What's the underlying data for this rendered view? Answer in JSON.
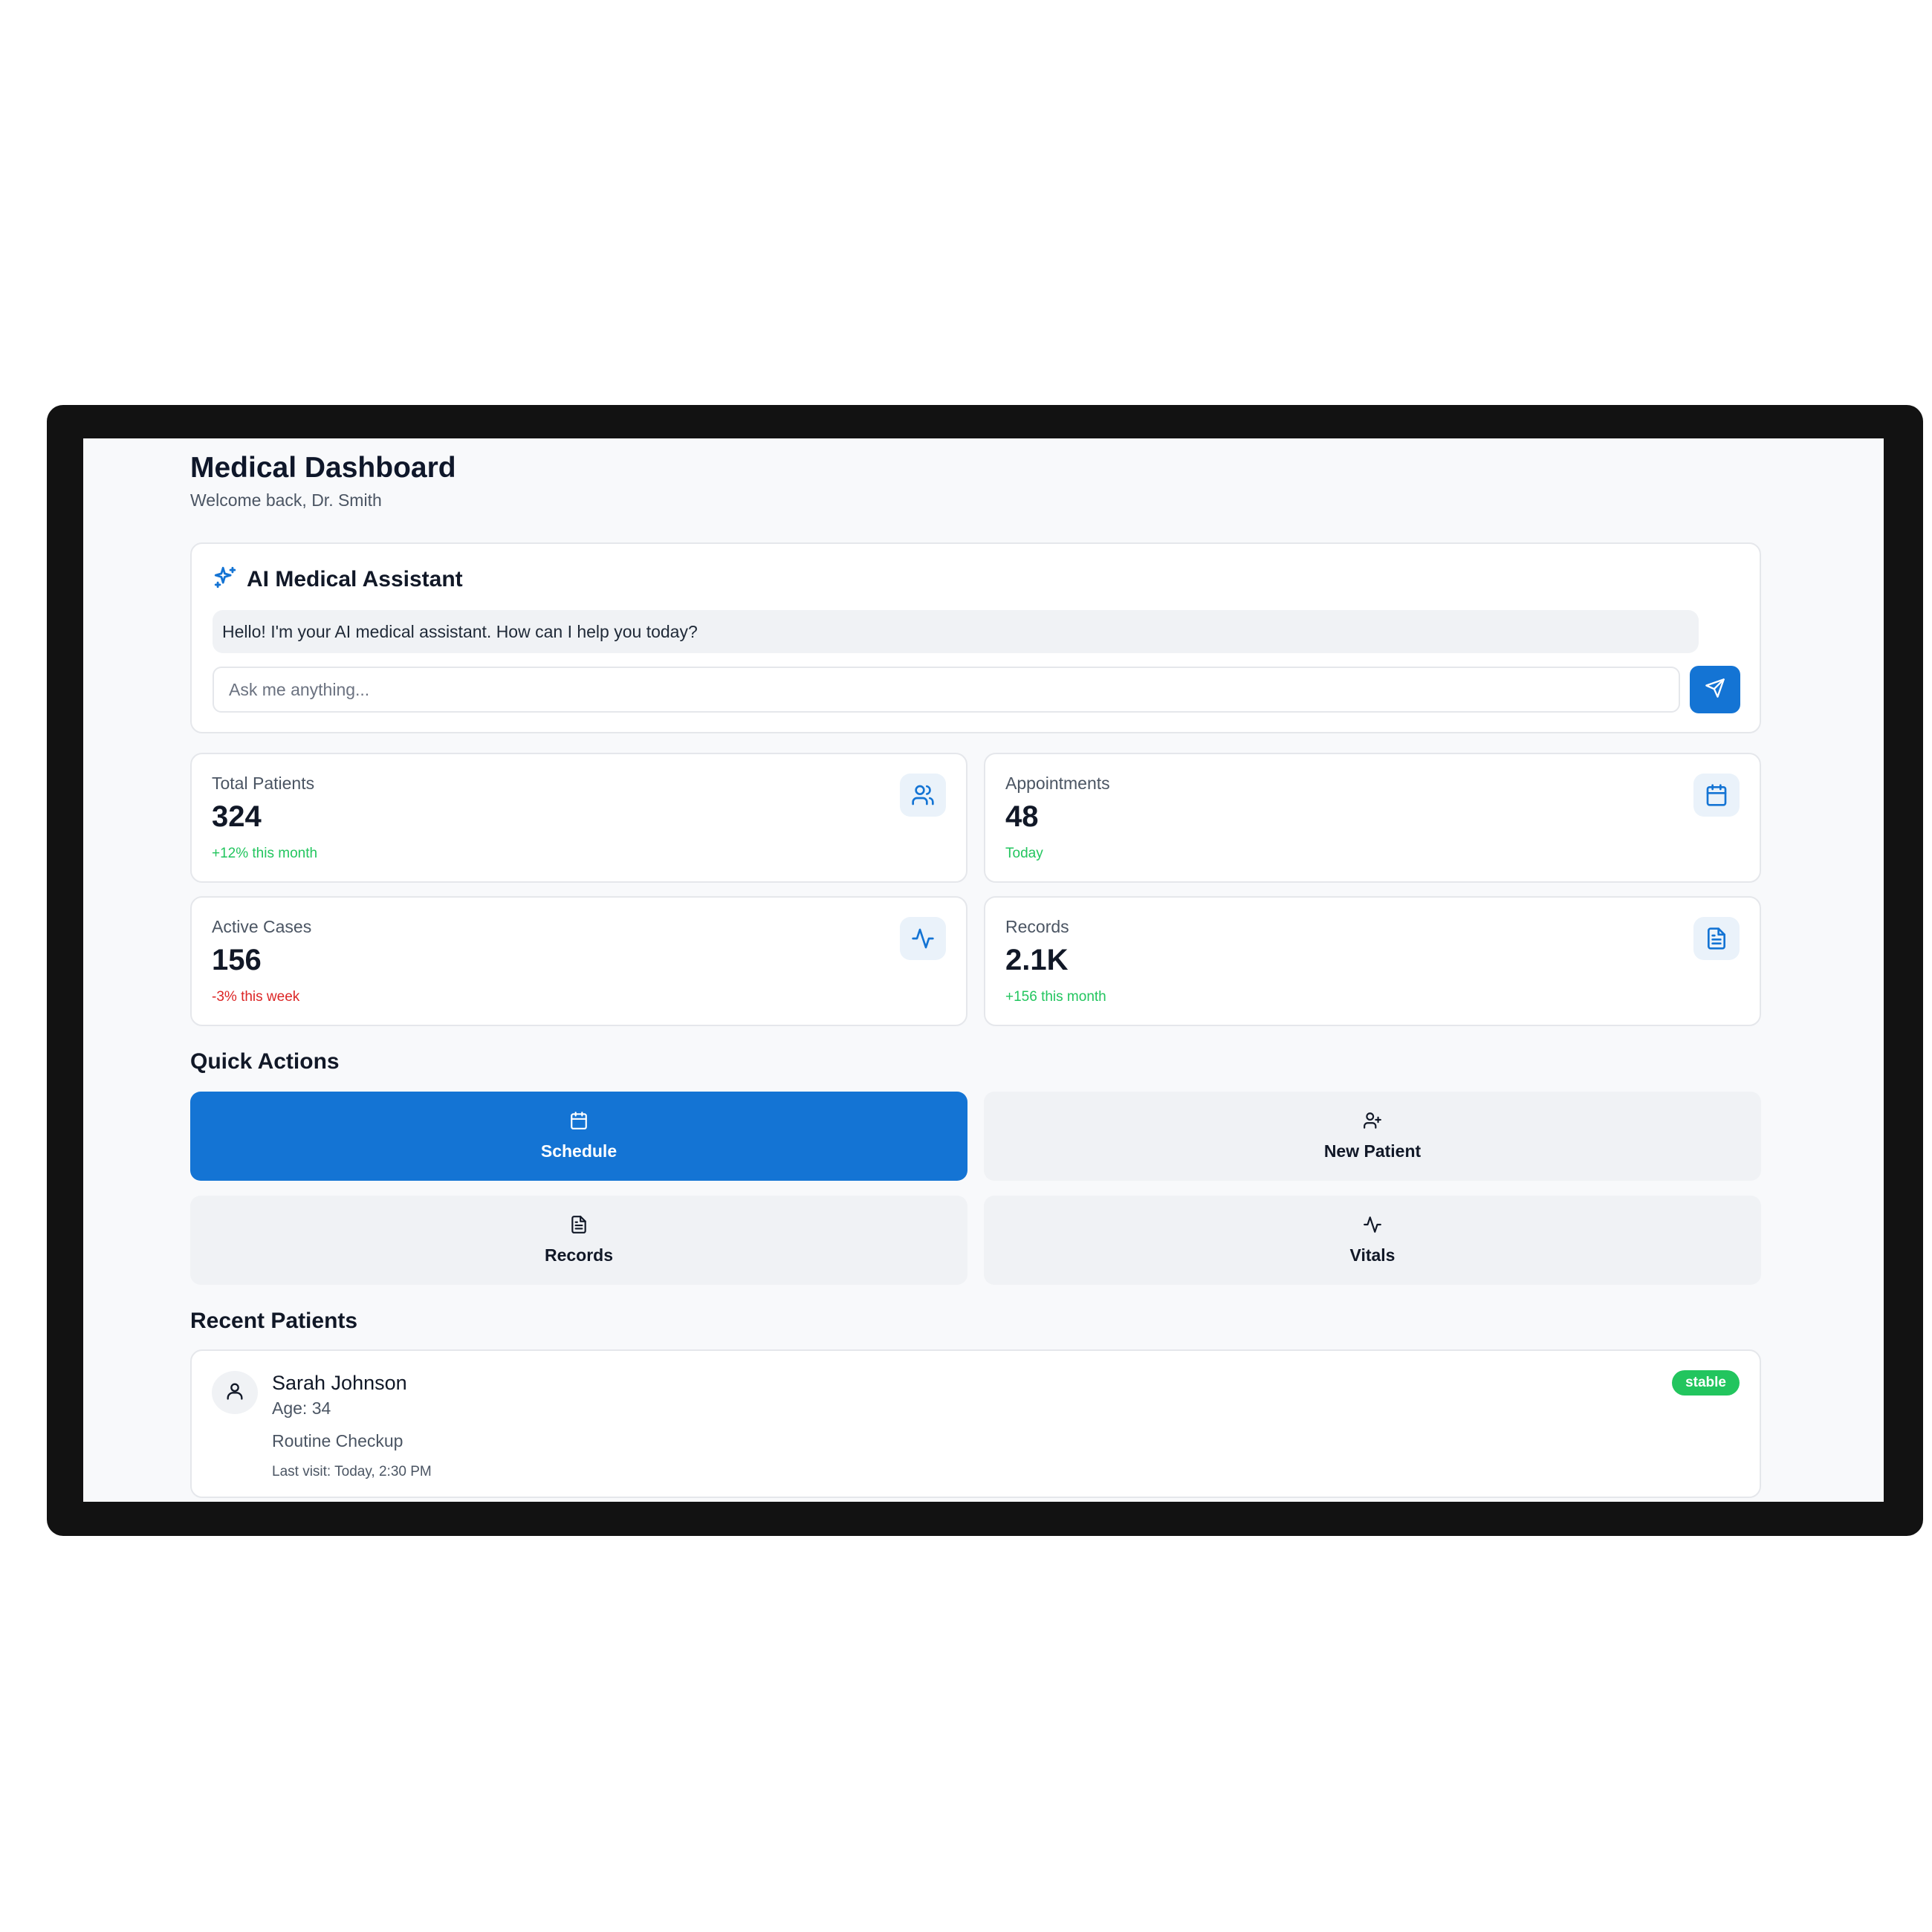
{
  "header": {
    "title": "Medical Dashboard",
    "subtitle": "Welcome back, Dr. Smith"
  },
  "assistant": {
    "title": "AI Medical Assistant",
    "icon": "sparkles-icon",
    "message": "Hello! I'm your AI medical assistant. How can I help you today?",
    "input_placeholder": "Ask me anything...",
    "input_value": "",
    "send_icon": "send-icon"
  },
  "stats": [
    {
      "label": "Total Patients",
      "value": "324",
      "delta": "+12% this month",
      "trend": "positive",
      "icon": "users-icon"
    },
    {
      "label": "Appointments",
      "value": "48",
      "delta": "Today",
      "trend": "positive",
      "icon": "calendar-icon"
    },
    {
      "label": "Active Cases",
      "value": "156",
      "delta": "-3% this week",
      "trend": "negative",
      "icon": "activity-icon"
    },
    {
      "label": "Records",
      "value": "2.1K",
      "delta": "+156 this month",
      "trend": "positive",
      "icon": "file-text-icon"
    }
  ],
  "quick_actions": {
    "title": "Quick Actions",
    "items": [
      {
        "label": "Schedule",
        "icon": "calendar-icon",
        "active": true
      },
      {
        "label": "New Patient",
        "icon": "user-plus-icon",
        "active": false
      },
      {
        "label": "Records",
        "icon": "file-text-icon",
        "active": false
      },
      {
        "label": "Vitals",
        "icon": "activity-icon",
        "active": false
      }
    ]
  },
  "recent_patients": {
    "title": "Recent Patients",
    "items": [
      {
        "name": "Sarah Johnson",
        "age": "Age: 34",
        "reason": "Routine Checkup",
        "last_visit": "Last visit: Today, 2:30 PM",
        "status": "stable"
      }
    ]
  },
  "colors": {
    "primary": "#1474d4",
    "positive": "#22c55e",
    "negative": "#dc2626",
    "surface": "#f8f9fb",
    "muted_bg": "#f0f2f5",
    "frame": "#121212"
  }
}
